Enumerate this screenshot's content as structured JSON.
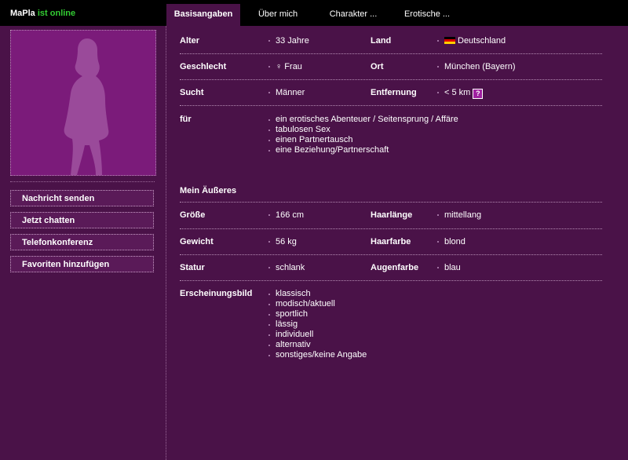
{
  "header": {
    "username": "MaPla",
    "status": "ist online",
    "tabs": [
      {
        "label": "Basisangaben",
        "active": true
      },
      {
        "label": "Über mich",
        "active": false
      },
      {
        "label": "Charakter ...",
        "active": false
      },
      {
        "label": "Erotische ...",
        "active": false
      }
    ]
  },
  "sidebar": {
    "actions": [
      "Nachricht senden",
      "Jetzt chatten",
      "Telefonkonferenz",
      "Favoriten hinzufügen"
    ]
  },
  "basics": {
    "age": {
      "label": "Alter",
      "value": "33 Jahre"
    },
    "country": {
      "label": "Land",
      "value": "Deutschland"
    },
    "gender": {
      "label": "Geschlecht",
      "value": "♀ Frau"
    },
    "city": {
      "label": "Ort",
      "value": "München (Bayern)"
    },
    "seeks": {
      "label": "Sucht",
      "value": "Männer"
    },
    "distance": {
      "label": "Entfernung",
      "value": "< 5 km",
      "help": "?"
    },
    "for": {
      "label": "für",
      "items": [
        "ein erotisches Abenteuer / Seitensprung / Affäre",
        "tabulosen Sex",
        "einen Partnertausch",
        "eine Beziehung/Partnerschaft"
      ]
    }
  },
  "appearance": {
    "title": "Mein Äußeres",
    "height": {
      "label": "Größe",
      "value": "166 cm"
    },
    "hair_length": {
      "label": "Haarlänge",
      "value": "mittellang"
    },
    "weight": {
      "label": "Gewicht",
      "value": "56 kg"
    },
    "hair_color": {
      "label": "Haarfarbe",
      "value": "blond"
    },
    "build": {
      "label": "Statur",
      "value": "schlank"
    },
    "eye_color": {
      "label": "Augenfarbe",
      "value": "blau"
    },
    "style": {
      "label": "Erscheinungsbild",
      "items": [
        "klassisch",
        "modisch/aktuell",
        "sportlich",
        "lässig",
        "individuell",
        "alternativ",
        "sonstiges/keine Angabe"
      ]
    }
  },
  "colors": {
    "background": "#4a1248",
    "topbar": "#000000",
    "online": "#33cc33",
    "photo_bg": "#7b1b7a"
  },
  "icons": {
    "silhouette": "female-silhouette-icon",
    "flag": "germany-flag-icon",
    "help": "help-icon"
  }
}
